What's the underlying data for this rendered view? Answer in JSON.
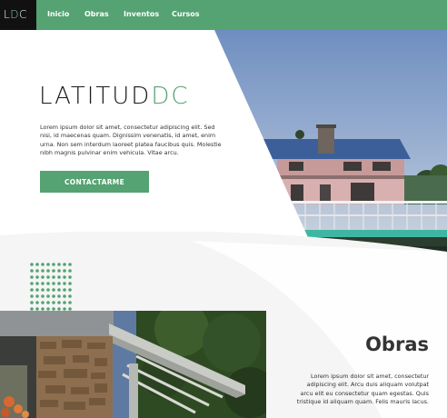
{
  "nav": {
    "logo": {
      "left": "L",
      "accent": "D",
      "right": "C"
    },
    "links": [
      "Inicio",
      "Obras",
      "Inventos",
      "Cursos"
    ],
    "background_color": "#55a272",
    "logo_background": "#111111"
  },
  "hero": {
    "brand": {
      "main": "LATITUD",
      "accent": "DC"
    },
    "paragraph": "Lorem ipsum dolor sit amet, consectetur adipiscing elit. Sed nisi, id maecenas quam. Dignissim venenatis, id amet, enim urna. Non sem interdum laoreet platea faucibus quis. Molestie nibh magnis pulvinar enim vehicula. Vitae arcu.",
    "cta_label": "CONTACTARME",
    "accent_color": "#55a272"
  },
  "obras": {
    "title": "Obras",
    "paragraph": "Lorem ipsum dolor sit amet, consectetur adipiscing elit. Arcu duis aliquam volutpat arcu elit eu consectetur quam egestas. Quis tristique id aliquam quam. Felis mauris lacus."
  }
}
